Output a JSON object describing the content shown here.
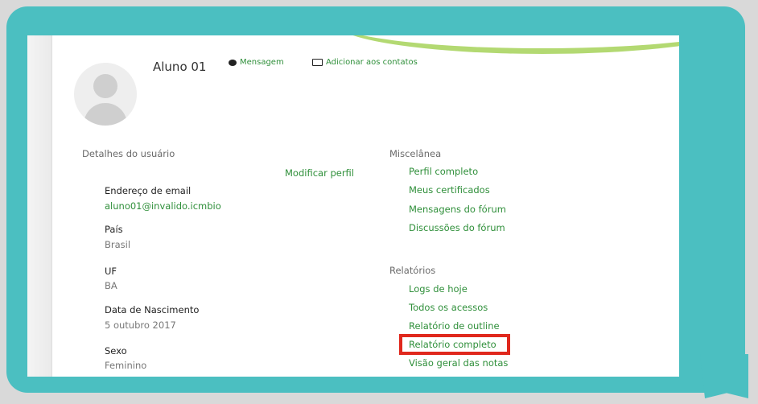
{
  "profile": {
    "name": "Aluno 01",
    "message_link": "Mensagem",
    "add_contacts_link": "Adicionar aos contatos"
  },
  "user_details": {
    "title": "Detalhes do usuário",
    "edit_link": "Modificar perfil",
    "fields": [
      {
        "label": "Endereço de email",
        "value": "aluno01@invalido.icmbio"
      },
      {
        "label": "País",
        "value": "Brasil"
      },
      {
        "label": "UF",
        "value": "BA"
      },
      {
        "label": "Data de Nascimento",
        "value": "5 outubro 2017"
      },
      {
        "label": "Sexo",
        "value": "Feminino"
      }
    ]
  },
  "misc": {
    "title": "Miscelânea",
    "links": [
      "Perfil completo",
      "Meus certificados",
      "Mensagens do fórum",
      "Discussões do fórum"
    ]
  },
  "reports": {
    "title": "Relatórios",
    "links": [
      "Logs de hoje",
      "Todos os acessos",
      "Relatório de outline",
      "Relatório completo",
      "Visão geral das notas"
    ]
  },
  "colors": {
    "bubble": "#4bbfc1",
    "link_green": "#2f8f3a",
    "highlight_red": "#e0281d"
  }
}
